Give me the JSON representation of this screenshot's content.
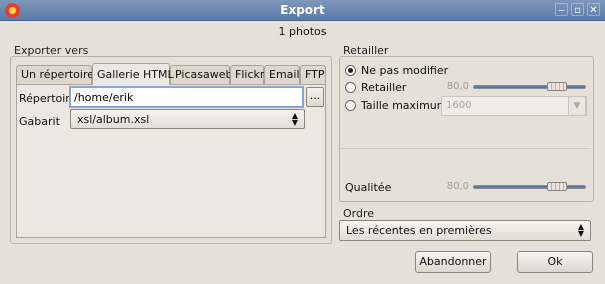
{
  "window": {
    "title": "Export"
  },
  "photo_count": "1 photos",
  "export_group": {
    "label": "Exporter vers",
    "tabs": [
      "Un répertoire",
      "Gallerie HTML",
      "Picasaweb",
      "Flickr",
      "Email",
      "FTP"
    ],
    "active_tab": "Gallerie HTML",
    "directory_label": "Répertoire",
    "directory_value": "/home/erik",
    "browse_label": "...",
    "template_label": "Gabarit",
    "template_value": "xsl/album.xsl"
  },
  "resize_group": {
    "label": "Retailler",
    "options": [
      "Ne pas modifier",
      "Retailler",
      "Taille maximum"
    ],
    "selected": "Ne pas modifier",
    "resize_value": "80,0",
    "resize_level": 0.8,
    "max_size_value": "1600",
    "quality_label": "Qualitée",
    "quality_value": "80,0",
    "quality_level": 0.8
  },
  "order_group": {
    "label": "Ordre",
    "value": "Les récentes en premières"
  },
  "buttons": {
    "cancel": "Abandonner",
    "ok": "Ok"
  }
}
